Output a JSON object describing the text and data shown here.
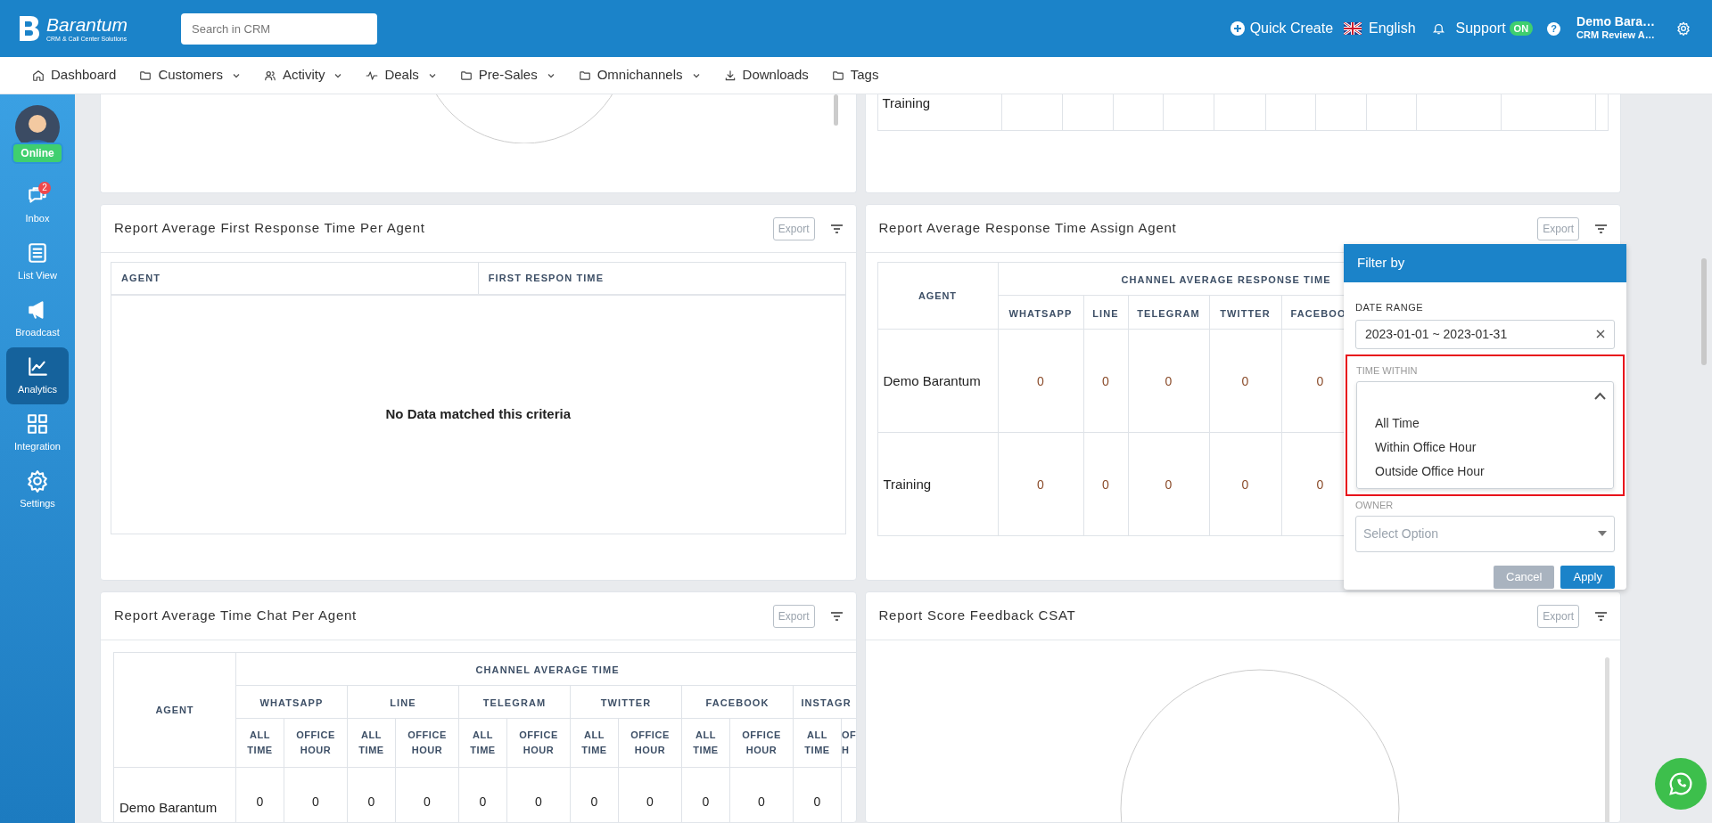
{
  "header": {
    "logo": {
      "name": "Barantum",
      "tagline": "CRM & Call Center Solutions"
    },
    "search": {
      "placeholder": "Search in CRM"
    },
    "quick_create": "Quick Create",
    "help": "?",
    "language": "English",
    "support": {
      "label": "Support",
      "badge": "ON"
    },
    "user": {
      "name": "Demo Bara…",
      "company": "CRM Review A…"
    }
  },
  "nav": [
    {
      "label": "Dashboard",
      "kind": "home",
      "dropdown": false
    },
    {
      "label": "Customers",
      "kind": "folder",
      "dropdown": true
    },
    {
      "label": "Activity",
      "kind": "people",
      "dropdown": true
    },
    {
      "label": "Deals",
      "kind": "pulse",
      "dropdown": true
    },
    {
      "label": "Pre-Sales",
      "kind": "folder",
      "dropdown": true
    },
    {
      "label": "Omnichannels",
      "kind": "folder",
      "dropdown": true
    },
    {
      "label": "Downloads",
      "kind": "download",
      "dropdown": false
    },
    {
      "label": "Tags",
      "kind": "folder",
      "dropdown": false
    }
  ],
  "sidebar": {
    "status": "Online",
    "items": [
      {
        "label": "Inbox",
        "kind": "chat",
        "badge": "2",
        "selected": false
      },
      {
        "label": "List View",
        "kind": "list",
        "selected": false
      },
      {
        "label": "Broadcast",
        "kind": "megaphone",
        "selected": false
      },
      {
        "label": "Analytics",
        "kind": "chart",
        "selected": true
      },
      {
        "label": "Integration",
        "kind": "grid",
        "selected": false
      },
      {
        "label": "Settings",
        "kind": "gear",
        "selected": false
      }
    ]
  },
  "panels": [
    {
      "kind": "pie_tail"
    },
    {
      "kind": "table_tail",
      "agent": "Training"
    },
    {
      "kind": "empty_table",
      "title": "Report Average First Response Time Per Agent",
      "export": "Export",
      "columns": [
        "AGENT",
        "FIRST RESPON TIME"
      ],
      "empty_text": "No Data matched this criteria"
    },
    {
      "kind": "response_table",
      "title": "Report Average Response Time Assign Agent",
      "export": "Export",
      "agent_column": "AGENT",
      "group": "CHANNEL AVERAGE RESPONSE TIME",
      "channels": [
        "WHATSAPP",
        "LINE",
        "TELEGRAM",
        "TWITTER",
        "FACEBOO"
      ],
      "rows": [
        {
          "agent": "Demo Barantum",
          "values": [
            "0",
            "0",
            "0",
            "0",
            "0"
          ]
        },
        {
          "agent": "Training",
          "values": [
            "0",
            "0",
            "0",
            "0",
            "0"
          ]
        }
      ]
    },
    {
      "kind": "chat_table",
      "title": "Report Average Time Chat Per Agent",
      "export": "Export",
      "agent_column": "AGENT",
      "group": "CHANNEL AVERAGE TIME",
      "channels": [
        "WHATSAPP",
        "LINE",
        "TELEGRAM",
        "TWITTER",
        "FACEBOOK",
        "INSTAGR"
      ],
      "sub_columns": [
        "ALL TIME",
        "OFFICE HOUR",
        "ALL TIME",
        "OFFICE HOUR",
        "ALL TIME",
        "OFFICE HOUR",
        "ALL TIME",
        "OFFICE HOUR",
        "ALL TIME",
        "OFFICE HOUR",
        "ALL TIME",
        "OF H"
      ],
      "rows": [
        {
          "agent": "Demo Barantum",
          "values": [
            "0",
            "0",
            "0",
            "0",
            "0",
            "0",
            "0",
            "0",
            "0",
            "0",
            "0"
          ]
        }
      ]
    },
    {
      "kind": "pie",
      "title": "Report Score Feedback CSAT",
      "export": "Export"
    }
  ],
  "filter": {
    "title": "Filter by",
    "date_range": {
      "label": "DATE RANGE",
      "value": "2023-01-01 ~ 2023-01-31"
    },
    "time_within": {
      "label": "TIME WITHIN",
      "expanded": true,
      "highlighted": true,
      "options": [
        "All Time",
        "Within Office Hour",
        "Outside Office Hour"
      ]
    },
    "owner": {
      "label": "OWNER",
      "placeholder": "Select Option"
    },
    "cancel": "Cancel",
    "apply": "Apply"
  }
}
